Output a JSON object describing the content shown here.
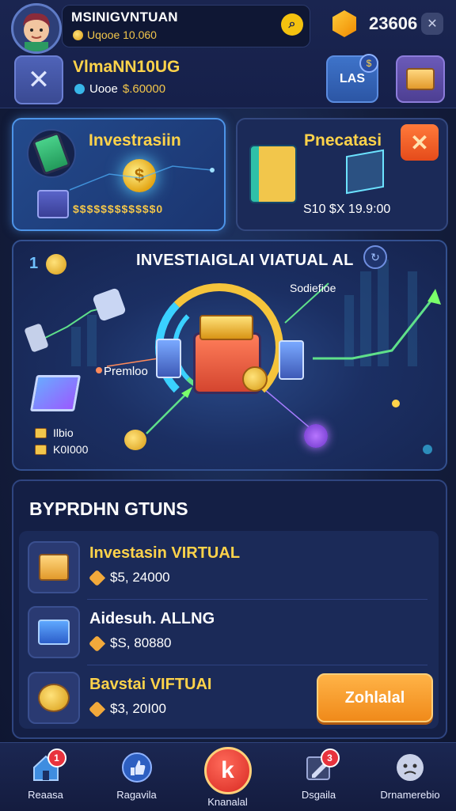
{
  "header": {
    "player_name": "MSINIGVNTUAN",
    "player_balance": "Uqooe 10.060",
    "gem_count": "23606",
    "account_name": "VlmaNN10UG",
    "account_prefix": "Uooe",
    "account_balance": "$.60000",
    "las_button": "LAS",
    "las_badge": "$"
  },
  "cards": [
    {
      "title": "Investrasiin",
      "stat": "$$$$$$$$$$$$0"
    },
    {
      "title": "Pnecatasi",
      "stat": "S10 $X 19.9:00"
    }
  ],
  "panel": {
    "number": "1",
    "title": "INVESTIAIGLAI VIATUAL AL",
    "label_right": "Sodiefioe",
    "label_left": "Premloo",
    "legend": [
      {
        "label": "Ilbio"
      },
      {
        "label": "K0I000"
      }
    ]
  },
  "section": {
    "title": "BYPRDHN GTUNS",
    "rows": [
      {
        "title": "Investasin VIRTUAL",
        "value": "$5, 24000",
        "color": "gold"
      },
      {
        "title": "Aidesuh. ALLNG",
        "value": "$S, 80880",
        "color": "white"
      },
      {
        "title": "Bavstai VIFTUAI",
        "value": "$3, 20I00",
        "color": "gold"
      }
    ],
    "action_button": "Zohlalal"
  },
  "nav": [
    {
      "label": "Reaasa",
      "badge": "1",
      "icon": "home-icon"
    },
    {
      "label": "Ragavila",
      "badge": "",
      "icon": "thumbs-up-icon"
    },
    {
      "label": "Knanalal",
      "badge": "",
      "icon": "k-logo-icon"
    },
    {
      "label": "Dsgaila",
      "badge": "3",
      "icon": "edit-icon"
    },
    {
      "label": "Drnamerebio",
      "badge": "",
      "icon": "face-icon"
    }
  ],
  "colors": {
    "accent_gold": "#ffd34a",
    "panel_bg": "#1b2f63",
    "button_orange": "#f08a1a"
  }
}
